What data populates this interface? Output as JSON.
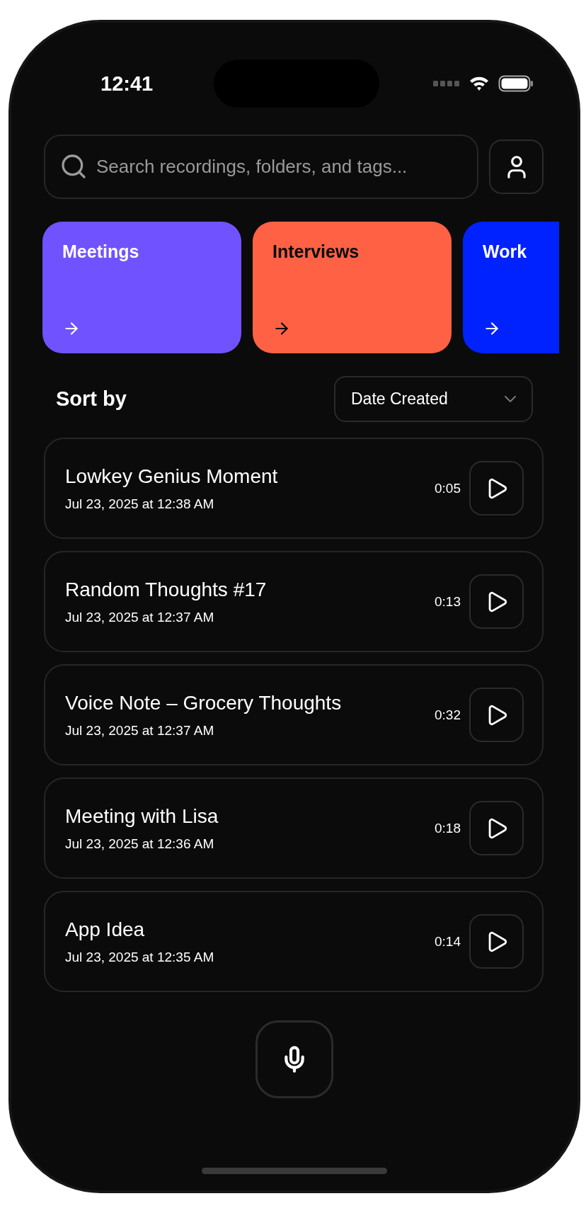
{
  "status_bar": {
    "time": "12:41"
  },
  "search": {
    "placeholder": "Search recordings, folders, and tags..."
  },
  "folders": [
    {
      "name": "Meetings",
      "color": "#7152ff",
      "dark_text": false
    },
    {
      "name": "Interviews",
      "color": "#ff6144",
      "dark_text": true
    },
    {
      "name": "Work",
      "color": "#0022ff",
      "dark_text": false
    }
  ],
  "sort": {
    "label": "Sort by",
    "value": "Date Created"
  },
  "recordings": [
    {
      "title": "Lowkey Genius Moment",
      "date": "Jul 23, 2025 at 12:38 AM",
      "duration": "0:05"
    },
    {
      "title": "Random Thoughts #17",
      "date": "Jul 23, 2025 at 12:37 AM",
      "duration": "0:13"
    },
    {
      "title": "Voice Note – Grocery Thoughts",
      "date": "Jul 23, 2025 at 12:37 AM",
      "duration": "0:32"
    },
    {
      "title": "Meeting with Lisa",
      "date": "Jul 23, 2025 at 12:36 AM",
      "duration": "0:18"
    },
    {
      "title": "App Idea",
      "date": "Jul 23, 2025 at 12:35 AM",
      "duration": "0:14"
    }
  ]
}
